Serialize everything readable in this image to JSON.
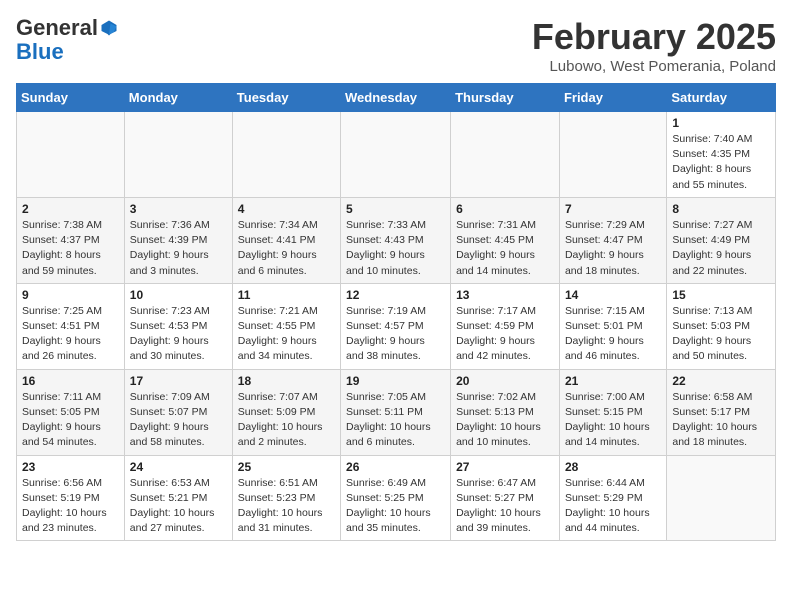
{
  "header": {
    "logo_general": "General",
    "logo_blue": "Blue",
    "main_title": "February 2025",
    "sub_title": "Lubowo, West Pomerania, Poland"
  },
  "days_of_week": [
    "Sunday",
    "Monday",
    "Tuesday",
    "Wednesday",
    "Thursday",
    "Friday",
    "Saturday"
  ],
  "weeks": [
    [
      {
        "day": "",
        "detail": ""
      },
      {
        "day": "",
        "detail": ""
      },
      {
        "day": "",
        "detail": ""
      },
      {
        "day": "",
        "detail": ""
      },
      {
        "day": "",
        "detail": ""
      },
      {
        "day": "",
        "detail": ""
      },
      {
        "day": "1",
        "detail": "Sunrise: 7:40 AM\nSunset: 4:35 PM\nDaylight: 8 hours and 55 minutes."
      }
    ],
    [
      {
        "day": "2",
        "detail": "Sunrise: 7:38 AM\nSunset: 4:37 PM\nDaylight: 8 hours and 59 minutes."
      },
      {
        "day": "3",
        "detail": "Sunrise: 7:36 AM\nSunset: 4:39 PM\nDaylight: 9 hours and 3 minutes."
      },
      {
        "day": "4",
        "detail": "Sunrise: 7:34 AM\nSunset: 4:41 PM\nDaylight: 9 hours and 6 minutes."
      },
      {
        "day": "5",
        "detail": "Sunrise: 7:33 AM\nSunset: 4:43 PM\nDaylight: 9 hours and 10 minutes."
      },
      {
        "day": "6",
        "detail": "Sunrise: 7:31 AM\nSunset: 4:45 PM\nDaylight: 9 hours and 14 minutes."
      },
      {
        "day": "7",
        "detail": "Sunrise: 7:29 AM\nSunset: 4:47 PM\nDaylight: 9 hours and 18 minutes."
      },
      {
        "day": "8",
        "detail": "Sunrise: 7:27 AM\nSunset: 4:49 PM\nDaylight: 9 hours and 22 minutes."
      }
    ],
    [
      {
        "day": "9",
        "detail": "Sunrise: 7:25 AM\nSunset: 4:51 PM\nDaylight: 9 hours and 26 minutes."
      },
      {
        "day": "10",
        "detail": "Sunrise: 7:23 AM\nSunset: 4:53 PM\nDaylight: 9 hours and 30 minutes."
      },
      {
        "day": "11",
        "detail": "Sunrise: 7:21 AM\nSunset: 4:55 PM\nDaylight: 9 hours and 34 minutes."
      },
      {
        "day": "12",
        "detail": "Sunrise: 7:19 AM\nSunset: 4:57 PM\nDaylight: 9 hours and 38 minutes."
      },
      {
        "day": "13",
        "detail": "Sunrise: 7:17 AM\nSunset: 4:59 PM\nDaylight: 9 hours and 42 minutes."
      },
      {
        "day": "14",
        "detail": "Sunrise: 7:15 AM\nSunset: 5:01 PM\nDaylight: 9 hours and 46 minutes."
      },
      {
        "day": "15",
        "detail": "Sunrise: 7:13 AM\nSunset: 5:03 PM\nDaylight: 9 hours and 50 minutes."
      }
    ],
    [
      {
        "day": "16",
        "detail": "Sunrise: 7:11 AM\nSunset: 5:05 PM\nDaylight: 9 hours and 54 minutes."
      },
      {
        "day": "17",
        "detail": "Sunrise: 7:09 AM\nSunset: 5:07 PM\nDaylight: 9 hours and 58 minutes."
      },
      {
        "day": "18",
        "detail": "Sunrise: 7:07 AM\nSunset: 5:09 PM\nDaylight: 10 hours and 2 minutes."
      },
      {
        "day": "19",
        "detail": "Sunrise: 7:05 AM\nSunset: 5:11 PM\nDaylight: 10 hours and 6 minutes."
      },
      {
        "day": "20",
        "detail": "Sunrise: 7:02 AM\nSunset: 5:13 PM\nDaylight: 10 hours and 10 minutes."
      },
      {
        "day": "21",
        "detail": "Sunrise: 7:00 AM\nSunset: 5:15 PM\nDaylight: 10 hours and 14 minutes."
      },
      {
        "day": "22",
        "detail": "Sunrise: 6:58 AM\nSunset: 5:17 PM\nDaylight: 10 hours and 18 minutes."
      }
    ],
    [
      {
        "day": "23",
        "detail": "Sunrise: 6:56 AM\nSunset: 5:19 PM\nDaylight: 10 hours and 23 minutes."
      },
      {
        "day": "24",
        "detail": "Sunrise: 6:53 AM\nSunset: 5:21 PM\nDaylight: 10 hours and 27 minutes."
      },
      {
        "day": "25",
        "detail": "Sunrise: 6:51 AM\nSunset: 5:23 PM\nDaylight: 10 hours and 31 minutes."
      },
      {
        "day": "26",
        "detail": "Sunrise: 6:49 AM\nSunset: 5:25 PM\nDaylight: 10 hours and 35 minutes."
      },
      {
        "day": "27",
        "detail": "Sunrise: 6:47 AM\nSunset: 5:27 PM\nDaylight: 10 hours and 39 minutes."
      },
      {
        "day": "28",
        "detail": "Sunrise: 6:44 AM\nSunset: 5:29 PM\nDaylight: 10 hours and 44 minutes."
      },
      {
        "day": "",
        "detail": ""
      }
    ]
  ]
}
